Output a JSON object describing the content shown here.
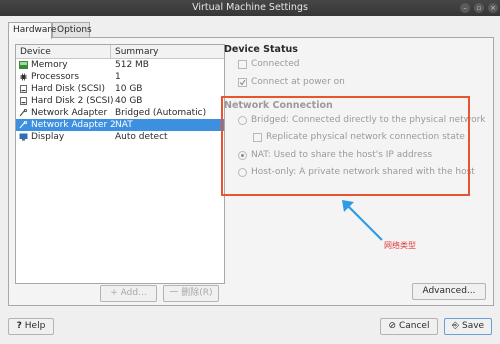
{
  "window": {
    "title": "Virtual Machine Settings"
  },
  "tabs": [
    {
      "label": "Hardware",
      "active": true
    },
    {
      "label": "Options",
      "active": false
    }
  ],
  "device_list": {
    "columns": [
      "Device",
      "Summary"
    ],
    "rows": [
      {
        "device": "Memory",
        "summary": "512 MB",
        "icon": "memory-icon",
        "selected": false
      },
      {
        "device": "Processors",
        "summary": "1",
        "icon": "processor-icon",
        "selected": false
      },
      {
        "device": "Hard Disk (SCSI)",
        "summary": "10 GB",
        "icon": "hard-disk-icon",
        "selected": false
      },
      {
        "device": "Hard Disk 2 (SCSI)",
        "summary": "40 GB",
        "icon": "hard-disk-icon",
        "selected": false
      },
      {
        "device": "Network Adapter",
        "summary": "Bridged (Automatic)",
        "icon": "network-adapter-icon",
        "selected": false
      },
      {
        "device": "Network Adapter 2",
        "summary": "NAT",
        "icon": "network-adapter-icon",
        "selected": true
      },
      {
        "device": "Display",
        "summary": "Auto detect",
        "icon": "display-icon",
        "selected": false
      }
    ]
  },
  "list_buttons": {
    "add": "+ Add...",
    "remove": "一 删除(R)"
  },
  "device_status": {
    "title": "Device Status",
    "connected": {
      "label": "Connected",
      "checked": false
    },
    "connect_at_power_on": {
      "label": "Connect at power on",
      "checked": true
    }
  },
  "network_connection": {
    "title": "Network Connection",
    "options": [
      {
        "label": "Bridged: Connected directly to the physical network",
        "selected": false
      },
      {
        "label": "NAT: Used to share the host's IP address",
        "selected": true
      },
      {
        "label": "Host-only: A private network shared with the host",
        "selected": false
      }
    ],
    "replicate": {
      "label": "Replicate physical network connection state",
      "checked": false
    }
  },
  "advanced_button": "Advanced...",
  "annotation": {
    "text": "网络类型",
    "color": "#e03a3a"
  },
  "footer": {
    "help": "Help",
    "cancel": "Cancel",
    "save": "Save"
  },
  "colors": {
    "selection": "#3d8fe0",
    "highlight_frame": "#e8542f",
    "arrow": "#2d9be6",
    "titlebar": "#3c3c3c"
  }
}
